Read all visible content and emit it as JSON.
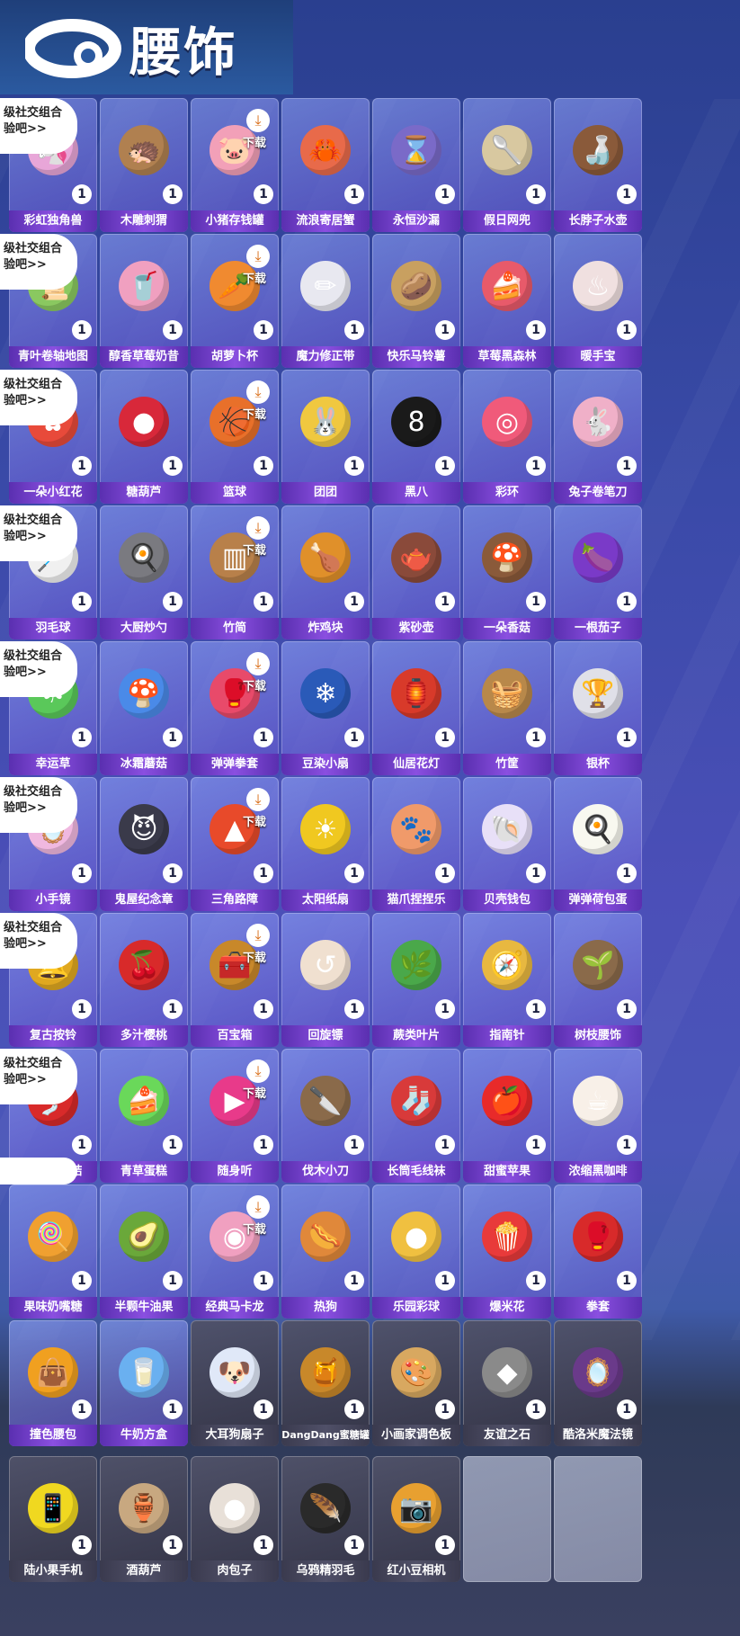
{
  "header": {
    "title": "腰饰",
    "icon": "belt-icon"
  },
  "social_tag": {
    "line1": "级社交组合",
    "line2": "验吧>>"
  },
  "download_label": "下载",
  "items": [
    {
      "name": "彩虹独角兽",
      "count": "1",
      "color": "#e8a6d8",
      "glyph": "🦄"
    },
    {
      "name": "木雕刺猬",
      "count": "1",
      "color": "#b08050",
      "glyph": "🦔"
    },
    {
      "name": "小猪存钱罐",
      "count": "1",
      "color": "#f2a0b8",
      "glyph": "🐷",
      "dl": true
    },
    {
      "name": "流浪寄居蟹",
      "count": "1",
      "color": "#e86a4a",
      "glyph": "🦀"
    },
    {
      "name": "永恒沙漏",
      "count": "1",
      "color": "#7a6ac8",
      "glyph": "⌛"
    },
    {
      "name": "假日网兜",
      "count": "1",
      "color": "#d8c8a0",
      "glyph": "🥄"
    },
    {
      "name": "长脖子水壶",
      "count": "1",
      "color": "#8a5a3a",
      "glyph": "🍶"
    },
    {
      "name": "青叶卷轴地图",
      "count": "1",
      "color": "#8ac860",
      "glyph": "📜"
    },
    {
      "name": "醇香草莓奶昔",
      "count": "1",
      "color": "#f0a0c0",
      "glyph": "🥤"
    },
    {
      "name": "胡萝卜杯",
      "count": "1",
      "color": "#f08a30",
      "glyph": "🥕",
      "dl": true
    },
    {
      "name": "魔力修正带",
      "count": "1",
      "color": "#e8e8f0",
      "glyph": "✏"
    },
    {
      "name": "快乐马铃薯",
      "count": "1",
      "color": "#c8a060",
      "glyph": "🥔"
    },
    {
      "name": "草莓黑森林",
      "count": "1",
      "color": "#e85a6a",
      "glyph": "🍰"
    },
    {
      "name": "暖手宝",
      "count": "1",
      "color": "#f0e0e0",
      "glyph": "♨"
    },
    {
      "name": "一朵小红花",
      "count": "1",
      "color": "#e84a3a",
      "glyph": "✿"
    },
    {
      "name": "糖葫芦",
      "count": "1",
      "color": "#d8283a",
      "glyph": "●"
    },
    {
      "name": "篮球",
      "count": "1",
      "color": "#e8702a",
      "glyph": "🏀",
      "dl": true
    },
    {
      "name": "团团",
      "count": "1",
      "color": "#f0c840",
      "glyph": "🐰"
    },
    {
      "name": "黑八",
      "count": "1",
      "color": "#1a1a1a",
      "glyph": "8"
    },
    {
      "name": "彩环",
      "count": "1",
      "color": "#f05a7a",
      "glyph": "◎"
    },
    {
      "name": "兔子卷笔刀",
      "count": "1",
      "color": "#f0b0c8",
      "glyph": "🐇"
    },
    {
      "name": "羽毛球",
      "count": "1",
      "color": "#f0f0f0",
      "glyph": "🏸"
    },
    {
      "name": "大厨炒勺",
      "count": "1",
      "color": "#7a7a80",
      "glyph": "🍳"
    },
    {
      "name": "竹简",
      "count": "1",
      "color": "#b8804a",
      "glyph": "▥",
      "dl": true
    },
    {
      "name": "炸鸡块",
      "count": "1",
      "color": "#e0902a",
      "glyph": "🍗"
    },
    {
      "name": "紫砂壶",
      "count": "1",
      "color": "#8a4a3a",
      "glyph": "🫖"
    },
    {
      "name": "一朵香菇",
      "count": "1",
      "color": "#8a5a3a",
      "glyph": "🍄"
    },
    {
      "name": "一根茄子",
      "count": "1",
      "color": "#7a3ac8",
      "glyph": "🍆"
    },
    {
      "name": "幸运草",
      "count": "1",
      "color": "#5ac85a",
      "glyph": "☘"
    },
    {
      "name": "冰霜蘑菇",
      "count": "1",
      "color": "#4a8ae8",
      "glyph": "🍄"
    },
    {
      "name": "弹弹拳套",
      "count": "1",
      "color": "#e84a6a",
      "glyph": "🥊",
      "dl": true
    },
    {
      "name": "豆染小扇",
      "count": "1",
      "color": "#2a5ab8",
      "glyph": "❄"
    },
    {
      "name": "仙居花灯",
      "count": "1",
      "color": "#d83a2a",
      "glyph": "🏮"
    },
    {
      "name": "竹筐",
      "count": "1",
      "color": "#b8884a",
      "glyph": "🧺"
    },
    {
      "name": "银杯",
      "count": "1",
      "color": "#e0e0e8",
      "glyph": "🏆"
    },
    {
      "name": "小手镜",
      "count": "1",
      "color": "#f0b8e0",
      "glyph": "🪞"
    },
    {
      "name": "鬼屋纪念章",
      "count": "1",
      "color": "#3a3a4a",
      "glyph": "😈"
    },
    {
      "name": "三角路障",
      "count": "1",
      "color": "#e84a2a",
      "glyph": "▲",
      "dl": true
    },
    {
      "name": "太阳纸扇",
      "count": "1",
      "color": "#f0c820",
      "glyph": "☀"
    },
    {
      "name": "猫爪捏捏乐",
      "count": "1",
      "color": "#f09a6a",
      "glyph": "🐾"
    },
    {
      "name": "贝壳钱包",
      "count": "1",
      "color": "#e8e0f8",
      "glyph": "🐚"
    },
    {
      "name": "弹弹荷包蛋",
      "count": "1",
      "color": "#f8f8f0",
      "glyph": "🍳"
    },
    {
      "name": "复古按铃",
      "count": "1",
      "color": "#e0a820",
      "glyph": "🔔"
    },
    {
      "name": "多汁樱桃",
      "count": "1",
      "color": "#d82a2a",
      "glyph": "🍒"
    },
    {
      "name": "百宝箱",
      "count": "1",
      "color": "#c8882a",
      "glyph": "🧰",
      "dl": true
    },
    {
      "name": "回旋镖",
      "count": "1",
      "color": "#f0e0d0",
      "glyph": "↺"
    },
    {
      "name": "蕨类叶片",
      "count": "1",
      "color": "#4aa84a",
      "glyph": "🌿"
    },
    {
      "name": "指南针",
      "count": "1",
      "color": "#e8b840",
      "glyph": "🧭"
    },
    {
      "name": "树枝腰饰",
      "count": "1",
      "color": "#8a6a4a",
      "glyph": "🌱"
    },
    {
      "name": "福禄中国结",
      "count": "1",
      "color": "#d82a2a",
      "glyph": "🎐"
    },
    {
      "name": "青草蛋糕",
      "count": "1",
      "color": "#6ad85a",
      "glyph": "🍰"
    },
    {
      "name": "随身听",
      "count": "1",
      "color": "#e83a8a",
      "glyph": "▶",
      "dl": true
    },
    {
      "name": "伐木小刀",
      "count": "1",
      "color": "#8a6a4a",
      "glyph": "🔪"
    },
    {
      "name": "长筒毛线袜",
      "count": "1",
      "color": "#d83a3a",
      "glyph": "🧦"
    },
    {
      "name": "甜蜜苹果",
      "count": "1",
      "color": "#e82a2a",
      "glyph": "🍎"
    },
    {
      "name": "浓缩黑咖啡",
      "count": "1",
      "color": "#f8f0e8",
      "glyph": "☕"
    },
    {
      "name": "果味奶嘴糖",
      "count": "1",
      "color": "#f0a030",
      "glyph": "🍭"
    },
    {
      "name": "半颗牛油果",
      "count": "1",
      "color": "#6aa83a",
      "glyph": "🥑"
    },
    {
      "name": "经典马卡龙",
      "count": "1",
      "color": "#f0a0c0",
      "glyph": "◉",
      "dl": true
    },
    {
      "name": "热狗",
      "count": "1",
      "color": "#e0883a",
      "glyph": "🌭"
    },
    {
      "name": "乐园彩球",
      "count": "1",
      "color": "#f0c040",
      "glyph": "●"
    },
    {
      "name": "爆米花",
      "count": "1",
      "color": "#e83a3a",
      "glyph": "🍿"
    },
    {
      "name": "拳套",
      "count": "1",
      "color": "#d82a2a",
      "glyph": "🥊"
    },
    {
      "name": "撞色腰包",
      "count": "1",
      "color": "#f0a020",
      "glyph": "👜"
    },
    {
      "name": "牛奶方盒",
      "count": "1",
      "color": "#6ab0f0",
      "glyph": "🥛"
    },
    {
      "name": "大耳狗扇子",
      "count": "1",
      "color": "#e0e8f8",
      "glyph": "🐶",
      "dark": true
    },
    {
      "name": "DangDang蜜糖罐",
      "count": "1",
      "color": "#c8882a",
      "glyph": "🍯",
      "dark": true
    },
    {
      "name": "小画家调色板",
      "count": "1",
      "color": "#d8a860",
      "glyph": "🎨",
      "dark": true
    },
    {
      "name": "友谊之石",
      "count": "1",
      "color": "#8a8a8a",
      "glyph": "◆",
      "dark": true
    },
    {
      "name": "酷洛米魔法镜",
      "count": "1",
      "color": "#6a3a8a",
      "glyph": "🪞",
      "dark": true
    },
    {
      "name": "陆小果手机",
      "count": "1",
      "color": "#f0d820",
      "glyph": "📱",
      "dark": true
    },
    {
      "name": "酒葫芦",
      "count": "1",
      "color": "#c8a880",
      "glyph": "🏺",
      "dark": true
    },
    {
      "name": "肉包子",
      "count": "1",
      "color": "#e8e0d8",
      "glyph": "●",
      "dark": true
    },
    {
      "name": "乌鸦精羽毛",
      "count": "1",
      "color": "#2a2a2a",
      "glyph": "🪶",
      "dark": true
    },
    {
      "name": "红小豆相机",
      "count": "1",
      "color": "#e8a030",
      "glyph": "📷",
      "dark": true
    },
    {
      "name": "",
      "count": "",
      "color": "",
      "glyph": "",
      "empty": true
    },
    {
      "name": "",
      "count": "",
      "color": "",
      "glyph": "",
      "empty": true
    }
  ]
}
